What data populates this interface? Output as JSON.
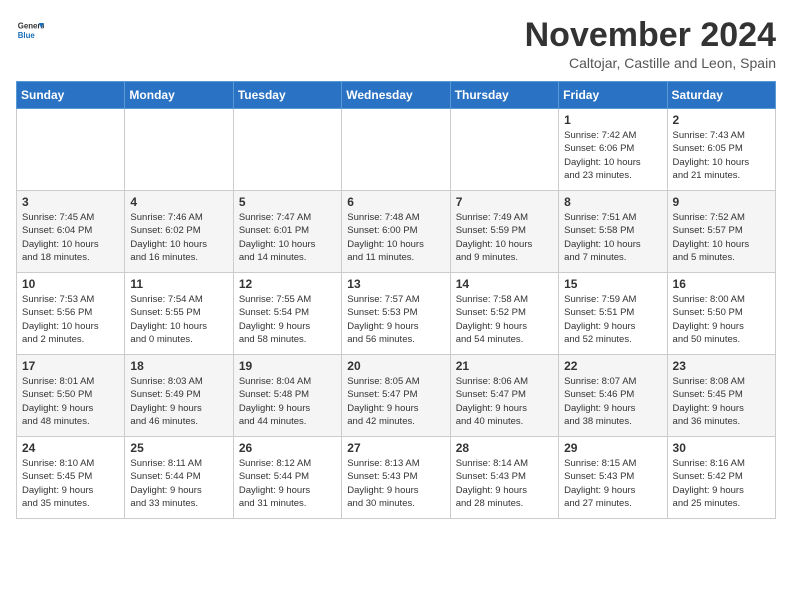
{
  "logo": {
    "general": "General",
    "blue": "Blue"
  },
  "title": "November 2024",
  "subtitle": "Caltojar, Castille and Leon, Spain",
  "weekdays": [
    "Sunday",
    "Monday",
    "Tuesday",
    "Wednesday",
    "Thursday",
    "Friday",
    "Saturday"
  ],
  "weeks": [
    [
      {
        "day": "",
        "content": ""
      },
      {
        "day": "",
        "content": ""
      },
      {
        "day": "",
        "content": ""
      },
      {
        "day": "",
        "content": ""
      },
      {
        "day": "",
        "content": ""
      },
      {
        "day": "1",
        "content": "Sunrise: 7:42 AM\nSunset: 6:06 PM\nDaylight: 10 hours\nand 23 minutes."
      },
      {
        "day": "2",
        "content": "Sunrise: 7:43 AM\nSunset: 6:05 PM\nDaylight: 10 hours\nand 21 minutes."
      }
    ],
    [
      {
        "day": "3",
        "content": "Sunrise: 7:45 AM\nSunset: 6:04 PM\nDaylight: 10 hours\nand 18 minutes."
      },
      {
        "day": "4",
        "content": "Sunrise: 7:46 AM\nSunset: 6:02 PM\nDaylight: 10 hours\nand 16 minutes."
      },
      {
        "day": "5",
        "content": "Sunrise: 7:47 AM\nSunset: 6:01 PM\nDaylight: 10 hours\nand 14 minutes."
      },
      {
        "day": "6",
        "content": "Sunrise: 7:48 AM\nSunset: 6:00 PM\nDaylight: 10 hours\nand 11 minutes."
      },
      {
        "day": "7",
        "content": "Sunrise: 7:49 AM\nSunset: 5:59 PM\nDaylight: 10 hours\nand 9 minutes."
      },
      {
        "day": "8",
        "content": "Sunrise: 7:51 AM\nSunset: 5:58 PM\nDaylight: 10 hours\nand 7 minutes."
      },
      {
        "day": "9",
        "content": "Sunrise: 7:52 AM\nSunset: 5:57 PM\nDaylight: 10 hours\nand 5 minutes."
      }
    ],
    [
      {
        "day": "10",
        "content": "Sunrise: 7:53 AM\nSunset: 5:56 PM\nDaylight: 10 hours\nand 2 minutes."
      },
      {
        "day": "11",
        "content": "Sunrise: 7:54 AM\nSunset: 5:55 PM\nDaylight: 10 hours\nand 0 minutes."
      },
      {
        "day": "12",
        "content": "Sunrise: 7:55 AM\nSunset: 5:54 PM\nDaylight: 9 hours\nand 58 minutes."
      },
      {
        "day": "13",
        "content": "Sunrise: 7:57 AM\nSunset: 5:53 PM\nDaylight: 9 hours\nand 56 minutes."
      },
      {
        "day": "14",
        "content": "Sunrise: 7:58 AM\nSunset: 5:52 PM\nDaylight: 9 hours\nand 54 minutes."
      },
      {
        "day": "15",
        "content": "Sunrise: 7:59 AM\nSunset: 5:51 PM\nDaylight: 9 hours\nand 52 minutes."
      },
      {
        "day": "16",
        "content": "Sunrise: 8:00 AM\nSunset: 5:50 PM\nDaylight: 9 hours\nand 50 minutes."
      }
    ],
    [
      {
        "day": "17",
        "content": "Sunrise: 8:01 AM\nSunset: 5:50 PM\nDaylight: 9 hours\nand 48 minutes."
      },
      {
        "day": "18",
        "content": "Sunrise: 8:03 AM\nSunset: 5:49 PM\nDaylight: 9 hours\nand 46 minutes."
      },
      {
        "day": "19",
        "content": "Sunrise: 8:04 AM\nSunset: 5:48 PM\nDaylight: 9 hours\nand 44 minutes."
      },
      {
        "day": "20",
        "content": "Sunrise: 8:05 AM\nSunset: 5:47 PM\nDaylight: 9 hours\nand 42 minutes."
      },
      {
        "day": "21",
        "content": "Sunrise: 8:06 AM\nSunset: 5:47 PM\nDaylight: 9 hours\nand 40 minutes."
      },
      {
        "day": "22",
        "content": "Sunrise: 8:07 AM\nSunset: 5:46 PM\nDaylight: 9 hours\nand 38 minutes."
      },
      {
        "day": "23",
        "content": "Sunrise: 8:08 AM\nSunset: 5:45 PM\nDaylight: 9 hours\nand 36 minutes."
      }
    ],
    [
      {
        "day": "24",
        "content": "Sunrise: 8:10 AM\nSunset: 5:45 PM\nDaylight: 9 hours\nand 35 minutes."
      },
      {
        "day": "25",
        "content": "Sunrise: 8:11 AM\nSunset: 5:44 PM\nDaylight: 9 hours\nand 33 minutes."
      },
      {
        "day": "26",
        "content": "Sunrise: 8:12 AM\nSunset: 5:44 PM\nDaylight: 9 hours\nand 31 minutes."
      },
      {
        "day": "27",
        "content": "Sunrise: 8:13 AM\nSunset: 5:43 PM\nDaylight: 9 hours\nand 30 minutes."
      },
      {
        "day": "28",
        "content": "Sunrise: 8:14 AM\nSunset: 5:43 PM\nDaylight: 9 hours\nand 28 minutes."
      },
      {
        "day": "29",
        "content": "Sunrise: 8:15 AM\nSunset: 5:43 PM\nDaylight: 9 hours\nand 27 minutes."
      },
      {
        "day": "30",
        "content": "Sunrise: 8:16 AM\nSunset: 5:42 PM\nDaylight: 9 hours\nand 25 minutes."
      }
    ]
  ]
}
